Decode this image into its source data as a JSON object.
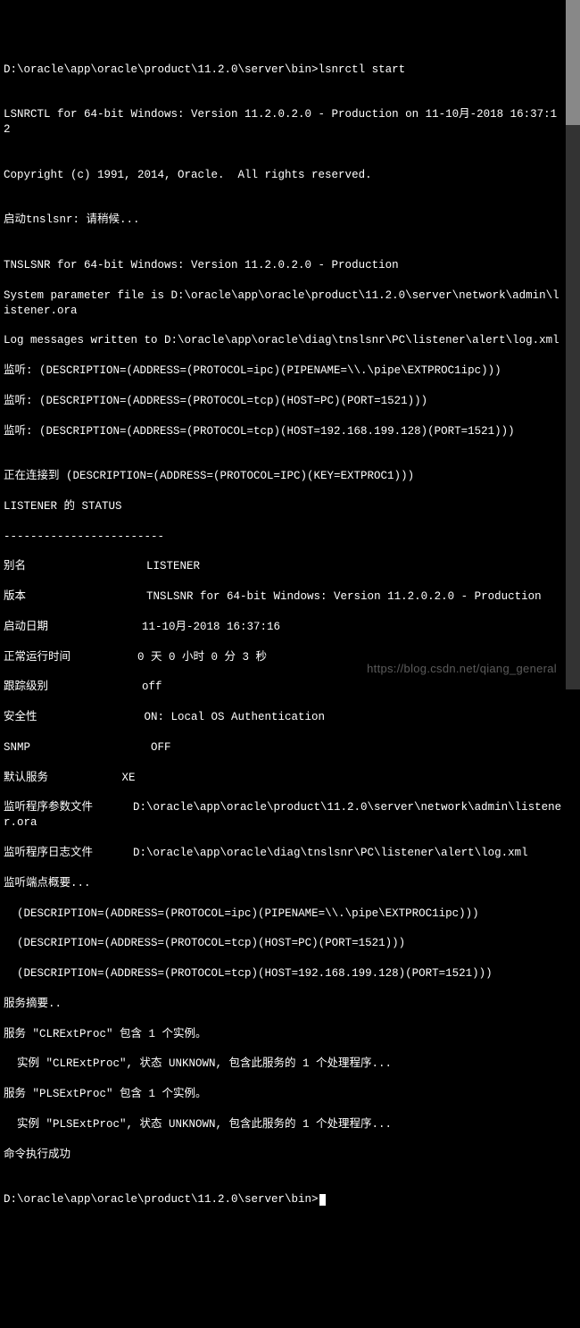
{
  "prompt1": "D:\\oracle\\app\\oracle\\product\\11.2.0\\server\\bin>lsnrctl start",
  "blank": "",
  "banner": "LSNRCTL for 64-bit Windows: Version 11.2.0.2.0 - Production on 11-10月-2018 16:37:12",
  "copyright": "Copyright (c) 1991, 2014, Oracle.  All rights reserved.",
  "starting": "启动tnslsnr: 请稍候...",
  "tnsBanner": "TNSLSNR for 64-bit Windows: Version 11.2.0.2.0 - Production",
  "paramFile": "System parameter file is D:\\oracle\\app\\oracle\\product\\11.2.0\\server\\network\\admin\\listener.ora",
  "logMsg": "Log messages written to D:\\oracle\\app\\oracle\\diag\\tnslsnr\\PC\\listener\\alert\\log.xml",
  "listen1": "监听: (DESCRIPTION=(ADDRESS=(PROTOCOL=ipc)(PIPENAME=\\\\.\\pipe\\EXTPROC1ipc)))",
  "listen2": "监听: (DESCRIPTION=(ADDRESS=(PROTOCOL=tcp)(HOST=PC)(PORT=1521)))",
  "listen3": "监听: (DESCRIPTION=(ADDRESS=(PROTOCOL=tcp)(HOST=192.168.199.128)(PORT=1521)))",
  "connecting": "正在连接到 (DESCRIPTION=(ADDRESS=(PROTOCOL=IPC)(KEY=EXTPROC1)))",
  "statusHeader": "LISTENER 的 STATUS",
  "divider": "------------------------",
  "rowAlias": "别名                  LISTENER",
  "rowVersion": "版本                  TNSLSNR for 64-bit Windows: Version 11.2.0.2.0 - Production",
  "rowStart": "启动日期              11-10月-2018 16:37:16",
  "rowUptime": "正常运行时间          0 天 0 小时 0 分 3 秒",
  "rowTrace": "跟踪级别              off",
  "rowSecurity": "安全性                ON: Local OS Authentication",
  "rowSnmp": "SNMP                  OFF",
  "rowDefault": "默认服务           XE",
  "rowParam": "监听程序参数文件      D:\\oracle\\app\\oracle\\product\\11.2.0\\server\\network\\admin\\listener.ora",
  "rowLog": "监听程序日志文件      D:\\oracle\\app\\oracle\\diag\\tnslsnr\\PC\\listener\\alert\\log.xml",
  "endpointsHdr": "监听端点概要...",
  "ep1": "  (DESCRIPTION=(ADDRESS=(PROTOCOL=ipc)(PIPENAME=\\\\.\\pipe\\EXTPROC1ipc)))",
  "ep2": "  (DESCRIPTION=(ADDRESS=(PROTOCOL=tcp)(HOST=PC)(PORT=1521)))",
  "ep3": "  (DESCRIPTION=(ADDRESS=(PROTOCOL=tcp)(HOST=192.168.199.128)(PORT=1521)))",
  "servicesHdr": "服务摘要..",
  "svc1a": "服务 \"CLRExtProc\" 包含 1 个实例。",
  "svc1b": "  实例 \"CLRExtProc\", 状态 UNKNOWN, 包含此服务的 1 个处理程序...",
  "svc2a": "服务 \"PLSExtProc\" 包含 1 个实例。",
  "svc2b": "  实例 \"PLSExtProc\", 状态 UNKNOWN, 包含此服务的 1 个处理程序...",
  "success": "命令执行成功",
  "prompt2": "D:\\oracle\\app\\oracle\\product\\11.2.0\\server\\bin>",
  "watermark": "https://blog.csdn.net/qiang_general"
}
